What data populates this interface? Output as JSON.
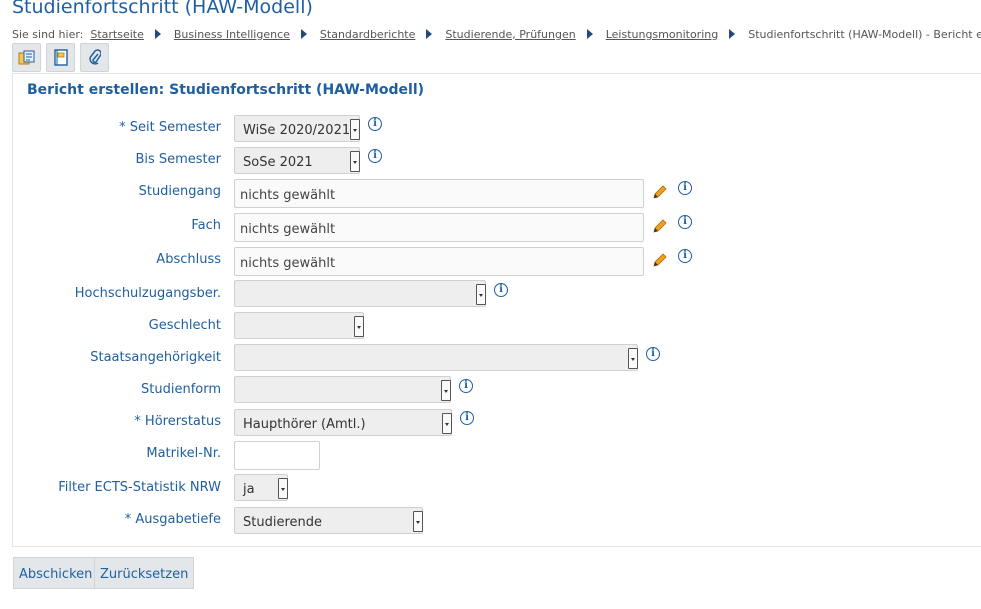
{
  "page": {
    "title": "Studienfortschritt (HAW-Modell)"
  },
  "breadcrumb": {
    "prefix": "Sie sind hier:",
    "items": [
      "Startseite",
      "Business Intelligence",
      "Standardberichte",
      "Studierende, Prüfungen",
      "Leistungsmonitoring"
    ],
    "current": "Studienfortschritt (HAW-Modell) - Bericht erstellen"
  },
  "toolbar": {
    "icons": [
      "report-export-icon",
      "notebook-icon",
      "paperclip-icon"
    ]
  },
  "form": {
    "heading": "Bericht erstellen: Studienfortschritt (HAW-Modell)",
    "fields": {
      "seit_semester": {
        "label": "* Seit Semester",
        "value": "WiSe 2020/2021"
      },
      "bis_semester": {
        "label": "Bis Semester",
        "value": "SoSe 2021"
      },
      "studiengang": {
        "label": "Studiengang",
        "value": "nichts gewählt"
      },
      "fach": {
        "label": "Fach",
        "value": "nichts gewählt"
      },
      "abschluss": {
        "label": "Abschluss",
        "value": "nichts gewählt"
      },
      "hochschulzugangsber": {
        "label": "Hochschulzugangsber.",
        "value": ""
      },
      "geschlecht": {
        "label": "Geschlecht",
        "value": ""
      },
      "staatsangehoerigkeit": {
        "label": "Staatsangehörigkeit",
        "value": ""
      },
      "studienform": {
        "label": "Studienform",
        "value": ""
      },
      "hoererstatus": {
        "label": "* Hörerstatus",
        "value": "Haupthörer (Amtl.)"
      },
      "matrikel_nr": {
        "label": "Matrikel-Nr.",
        "value": ""
      },
      "filter_ects": {
        "label": "Filter ECTS-Statistik NRW",
        "value": "ja"
      },
      "ausgabetiefe": {
        "label": "* Ausgabetiefe",
        "value": "Studierende"
      }
    }
  },
  "actions": {
    "submit_label": "Abschicken",
    "reset_label": "Zurücksetzen"
  },
  "colors": {
    "accent": "#1f5fa0",
    "edit_icon": "#f0a020",
    "button_bg": "#e4e7ea"
  }
}
